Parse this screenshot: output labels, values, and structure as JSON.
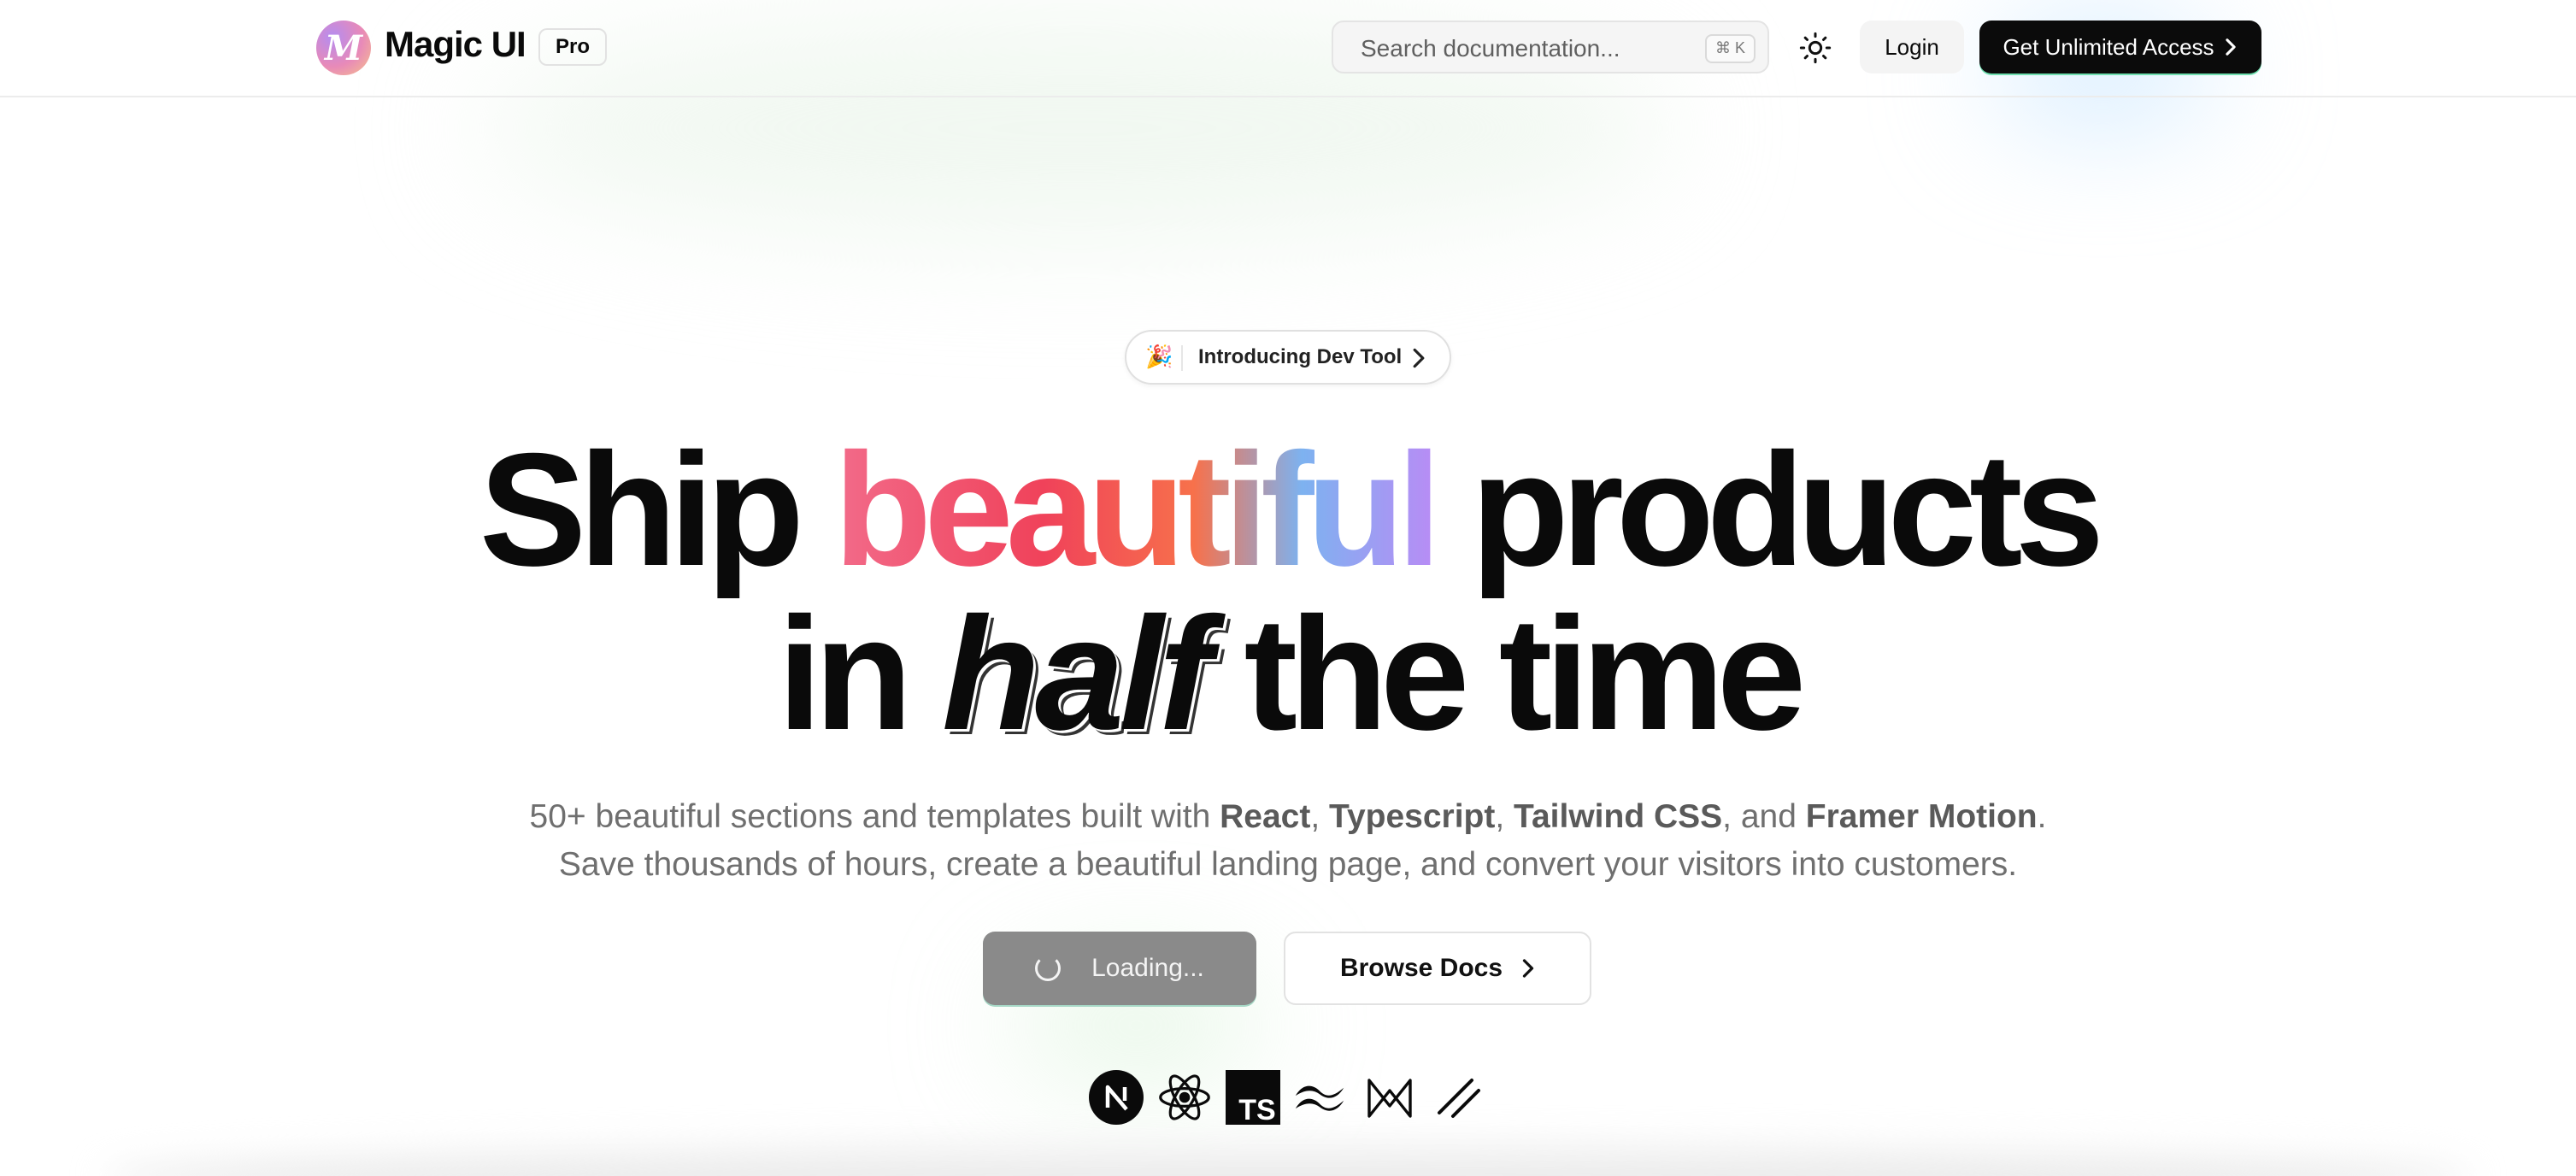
{
  "header": {
    "logo_letter": "M",
    "brand": "Magic UI",
    "badge": "Pro",
    "search": {
      "placeholder": "Search documentation...",
      "shortcut": "⌘ K"
    },
    "theme_icon": "sun-icon",
    "login_label": "Login",
    "cta_label": "Get Unlimited Access"
  },
  "announcement": {
    "emoji": "🎉",
    "label": "Introducing Dev Tool"
  },
  "hero": {
    "line1": {
      "start": "Ship",
      "highlight": "beautiful",
      "end": "products"
    },
    "line2": {
      "start": "in",
      "emphasis": "half",
      "end": "the time"
    },
    "subtitle": {
      "prefix": "50+ beautiful sections and templates built with",
      "tech1": "React",
      "tech2": "Typescript",
      "tech3": "Tailwind CSS",
      "and": ", and",
      "tech4": "Framer Motion",
      "line2": "Save thousands of hours, create a beautiful landing page, and convert your visitors into customers."
    }
  },
  "actions": {
    "loading_label": "Loading...",
    "docs_label": "Browse Docs"
  },
  "tech_icons": [
    "nextjs-icon",
    "react-icon",
    "typescript-icon",
    "tailwind-icon",
    "framer-motion-icon",
    "shadcn-icon"
  ],
  "colors": {
    "accent_gradient": [
      "#f26b8a",
      "#f0425a",
      "#f7714b",
      "#7db2f0",
      "#b88cf5"
    ],
    "cta_background": "#0b0b0b",
    "loading_background": "#8a8a8a"
  }
}
